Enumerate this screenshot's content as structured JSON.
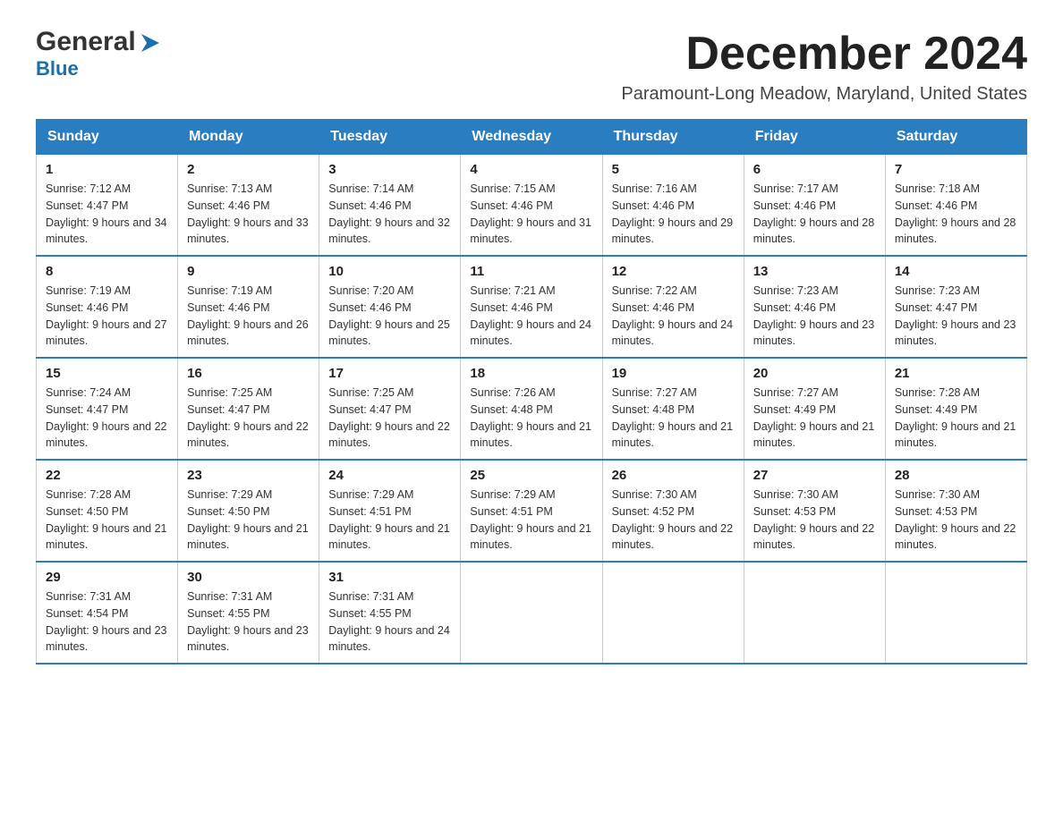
{
  "header": {
    "logo": {
      "general": "General",
      "blue": "Blue",
      "arrow_color": "#1a6faf"
    },
    "title": "December 2024",
    "subtitle": "Paramount-Long Meadow, Maryland, United States"
  },
  "calendar": {
    "days_of_week": [
      "Sunday",
      "Monday",
      "Tuesday",
      "Wednesday",
      "Thursday",
      "Friday",
      "Saturday"
    ],
    "weeks": [
      [
        {
          "day": "1",
          "sunrise": "Sunrise: 7:12 AM",
          "sunset": "Sunset: 4:47 PM",
          "daylight": "Daylight: 9 hours and 34 minutes."
        },
        {
          "day": "2",
          "sunrise": "Sunrise: 7:13 AM",
          "sunset": "Sunset: 4:46 PM",
          "daylight": "Daylight: 9 hours and 33 minutes."
        },
        {
          "day": "3",
          "sunrise": "Sunrise: 7:14 AM",
          "sunset": "Sunset: 4:46 PM",
          "daylight": "Daylight: 9 hours and 32 minutes."
        },
        {
          "day": "4",
          "sunrise": "Sunrise: 7:15 AM",
          "sunset": "Sunset: 4:46 PM",
          "daylight": "Daylight: 9 hours and 31 minutes."
        },
        {
          "day": "5",
          "sunrise": "Sunrise: 7:16 AM",
          "sunset": "Sunset: 4:46 PM",
          "daylight": "Daylight: 9 hours and 29 minutes."
        },
        {
          "day": "6",
          "sunrise": "Sunrise: 7:17 AM",
          "sunset": "Sunset: 4:46 PM",
          "daylight": "Daylight: 9 hours and 28 minutes."
        },
        {
          "day": "7",
          "sunrise": "Sunrise: 7:18 AM",
          "sunset": "Sunset: 4:46 PM",
          "daylight": "Daylight: 9 hours and 28 minutes."
        }
      ],
      [
        {
          "day": "8",
          "sunrise": "Sunrise: 7:19 AM",
          "sunset": "Sunset: 4:46 PM",
          "daylight": "Daylight: 9 hours and 27 minutes."
        },
        {
          "day": "9",
          "sunrise": "Sunrise: 7:19 AM",
          "sunset": "Sunset: 4:46 PM",
          "daylight": "Daylight: 9 hours and 26 minutes."
        },
        {
          "day": "10",
          "sunrise": "Sunrise: 7:20 AM",
          "sunset": "Sunset: 4:46 PM",
          "daylight": "Daylight: 9 hours and 25 minutes."
        },
        {
          "day": "11",
          "sunrise": "Sunrise: 7:21 AM",
          "sunset": "Sunset: 4:46 PM",
          "daylight": "Daylight: 9 hours and 24 minutes."
        },
        {
          "day": "12",
          "sunrise": "Sunrise: 7:22 AM",
          "sunset": "Sunset: 4:46 PM",
          "daylight": "Daylight: 9 hours and 24 minutes."
        },
        {
          "day": "13",
          "sunrise": "Sunrise: 7:23 AM",
          "sunset": "Sunset: 4:46 PM",
          "daylight": "Daylight: 9 hours and 23 minutes."
        },
        {
          "day": "14",
          "sunrise": "Sunrise: 7:23 AM",
          "sunset": "Sunset: 4:47 PM",
          "daylight": "Daylight: 9 hours and 23 minutes."
        }
      ],
      [
        {
          "day": "15",
          "sunrise": "Sunrise: 7:24 AM",
          "sunset": "Sunset: 4:47 PM",
          "daylight": "Daylight: 9 hours and 22 minutes."
        },
        {
          "day": "16",
          "sunrise": "Sunrise: 7:25 AM",
          "sunset": "Sunset: 4:47 PM",
          "daylight": "Daylight: 9 hours and 22 minutes."
        },
        {
          "day": "17",
          "sunrise": "Sunrise: 7:25 AM",
          "sunset": "Sunset: 4:47 PM",
          "daylight": "Daylight: 9 hours and 22 minutes."
        },
        {
          "day": "18",
          "sunrise": "Sunrise: 7:26 AM",
          "sunset": "Sunset: 4:48 PM",
          "daylight": "Daylight: 9 hours and 21 minutes."
        },
        {
          "day": "19",
          "sunrise": "Sunrise: 7:27 AM",
          "sunset": "Sunset: 4:48 PM",
          "daylight": "Daylight: 9 hours and 21 minutes."
        },
        {
          "day": "20",
          "sunrise": "Sunrise: 7:27 AM",
          "sunset": "Sunset: 4:49 PM",
          "daylight": "Daylight: 9 hours and 21 minutes."
        },
        {
          "day": "21",
          "sunrise": "Sunrise: 7:28 AM",
          "sunset": "Sunset: 4:49 PM",
          "daylight": "Daylight: 9 hours and 21 minutes."
        }
      ],
      [
        {
          "day": "22",
          "sunrise": "Sunrise: 7:28 AM",
          "sunset": "Sunset: 4:50 PM",
          "daylight": "Daylight: 9 hours and 21 minutes."
        },
        {
          "day": "23",
          "sunrise": "Sunrise: 7:29 AM",
          "sunset": "Sunset: 4:50 PM",
          "daylight": "Daylight: 9 hours and 21 minutes."
        },
        {
          "day": "24",
          "sunrise": "Sunrise: 7:29 AM",
          "sunset": "Sunset: 4:51 PM",
          "daylight": "Daylight: 9 hours and 21 minutes."
        },
        {
          "day": "25",
          "sunrise": "Sunrise: 7:29 AM",
          "sunset": "Sunset: 4:51 PM",
          "daylight": "Daylight: 9 hours and 21 minutes."
        },
        {
          "day": "26",
          "sunrise": "Sunrise: 7:30 AM",
          "sunset": "Sunset: 4:52 PM",
          "daylight": "Daylight: 9 hours and 22 minutes."
        },
        {
          "day": "27",
          "sunrise": "Sunrise: 7:30 AM",
          "sunset": "Sunset: 4:53 PM",
          "daylight": "Daylight: 9 hours and 22 minutes."
        },
        {
          "day": "28",
          "sunrise": "Sunrise: 7:30 AM",
          "sunset": "Sunset: 4:53 PM",
          "daylight": "Daylight: 9 hours and 22 minutes."
        }
      ],
      [
        {
          "day": "29",
          "sunrise": "Sunrise: 7:31 AM",
          "sunset": "Sunset: 4:54 PM",
          "daylight": "Daylight: 9 hours and 23 minutes."
        },
        {
          "day": "30",
          "sunrise": "Sunrise: 7:31 AM",
          "sunset": "Sunset: 4:55 PM",
          "daylight": "Daylight: 9 hours and 23 minutes."
        },
        {
          "day": "31",
          "sunrise": "Sunrise: 7:31 AM",
          "sunset": "Sunset: 4:55 PM",
          "daylight": "Daylight: 9 hours and 24 minutes."
        },
        null,
        null,
        null,
        null
      ]
    ]
  }
}
